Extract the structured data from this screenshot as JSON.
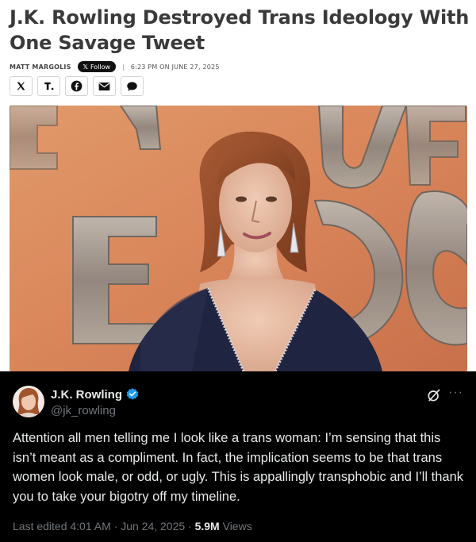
{
  "article": {
    "headline": "J.K. Rowling Destroyed Trans Ideology With One Savage Tweet",
    "author": "MATT MARGOLIS",
    "follow_label": "Follow",
    "follow_prefix": "𝕏",
    "separator": "|",
    "date": "6:23 PM ON JUNE 27, 2025"
  },
  "share": [
    {
      "icon": "x-logo-icon"
    },
    {
      "icon": "truth-social-icon"
    },
    {
      "icon": "facebook-icon"
    },
    {
      "icon": "email-icon"
    },
    {
      "icon": "comment-icon"
    }
  ],
  "tweet": {
    "name": "J.K. Rowling",
    "handle": "@jk_rowling",
    "more": "···",
    "text": "Attention all men telling me I look like a trans woman: I’m sensing that this isn’t meant as a compliment. In fact, the implication seems to be that trans women look male, or odd, or ugly. This is appallingly transphobic and I’ll thank you to take your bigotry off my timeline.",
    "edited": "Last edited 4:01 AM · Jun 24, 2025 · ",
    "views_count": "5.9M",
    "views_label": " Views"
  },
  "colors": {
    "tweet_bg": "#000000",
    "verified": "#1d9bf0",
    "muted": "#71767b",
    "hero_bg": "#d98a5c"
  }
}
